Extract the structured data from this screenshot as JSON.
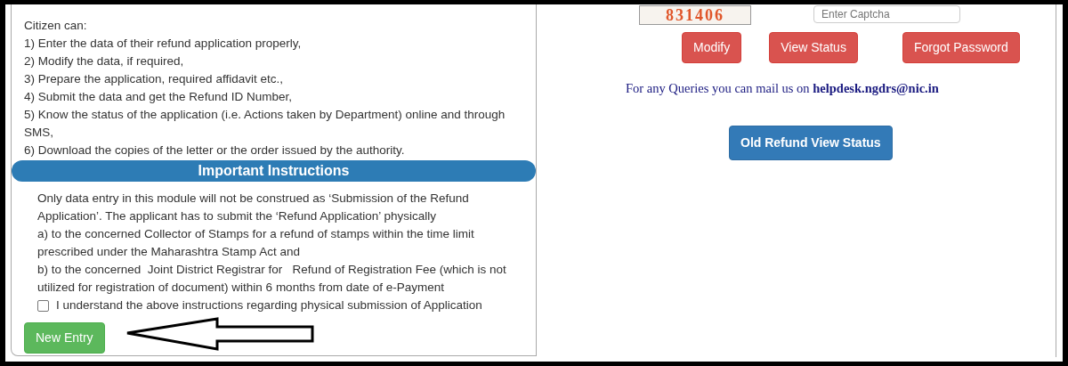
{
  "intro": {
    "heading": "Citizen can:",
    "items": [
      "1) Enter the data of their refund application properly,",
      "2) Modify the data, if required,",
      "3) Prepare the application, required affidavit etc.,",
      "4) Submit the data and get the Refund ID Number,",
      "5) Know the status of the application (i.e. Actions taken by Department) online and through SMS,",
      "6) Download the copies of the letter or the order issued by the authority."
    ]
  },
  "instructions": {
    "heading": "Important Instructions",
    "paragraphs": [
      "Only data entry in this module will not be construed as ‘Submission of the Refund Application’. The applicant has to submit the ‘Refund Application’ physically",
      "a) to the concerned Collector of Stamps for a refund of stamps within the time limit prescribed under the Maharashtra Stamp Act and",
      "b) to the concerned  Joint District Registrar for   Refund of Registration Fee (which is not utilized for registration of document) within 6 months from date of e-Payment"
    ],
    "checkbox": {
      "label": "I understand the above instructions regarding physical submission of Application",
      "checked": false
    }
  },
  "new_entry_button": "New Entry",
  "captcha": {
    "code": "831406",
    "placeholder": "Enter Captcha"
  },
  "buttons": [
    "Modify",
    "View Status",
    "Forgot Password"
  ],
  "query_text": "For any Queries you can mail us on **helpdesk.ngdrs@nic.in**",
  "old_refund_button": "Old Refund View Status"
}
